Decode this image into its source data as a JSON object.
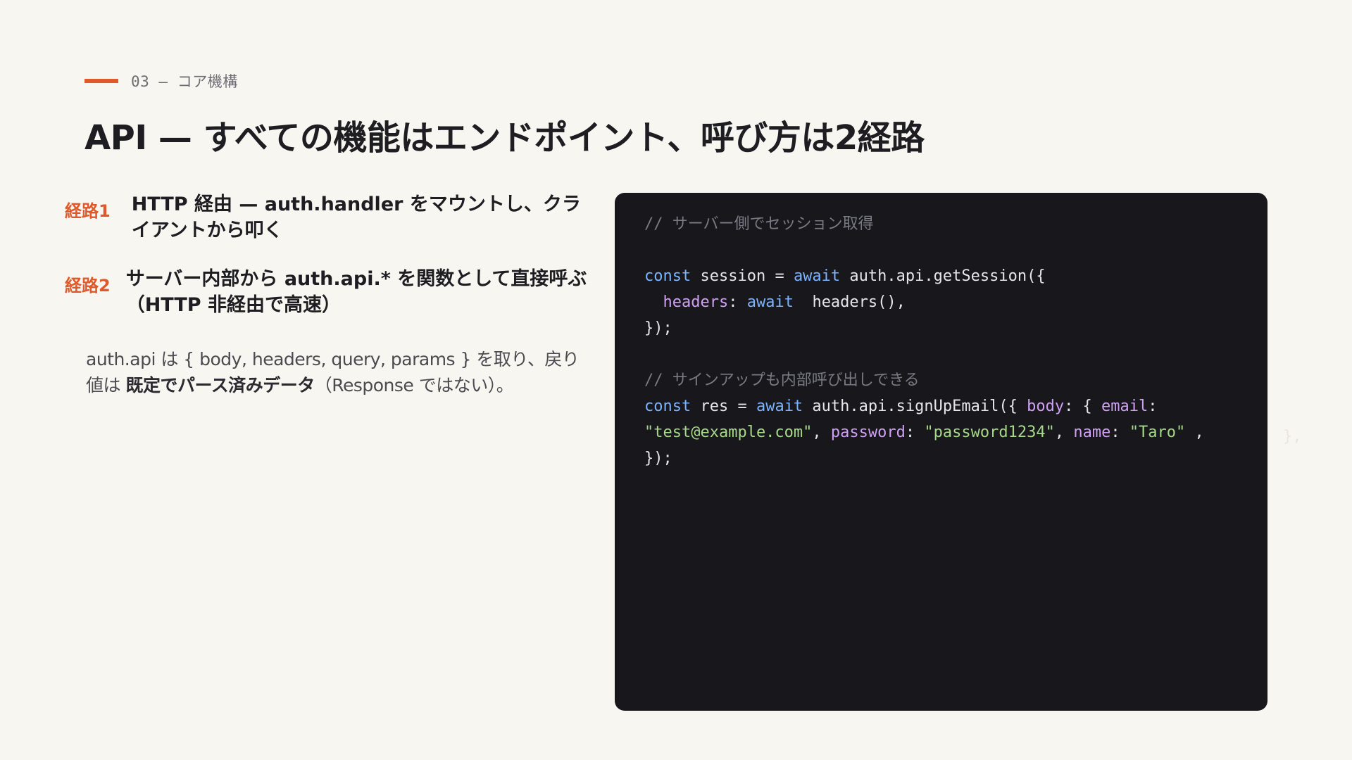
{
  "eyebrow": {
    "label": "03 — コア機構"
  },
  "title": "API — すべての機能はエンドポイント、呼び方は2経路",
  "routes": [
    {
      "label": "経路1",
      "text": "HTTP 経由 — auth.handler をマウントし、クライアントから叩く"
    },
    {
      "label": "経路2",
      "text": "サーバー内部から auth.api.* を関数として直接呼ぶ（HTTP 非経由で高速）"
    }
  ],
  "description": {
    "before": "auth.api は { body, headers, query, params } を取り、戻り値は ",
    "emphasis": "既定でパース済みデータ",
    "after": "（Response ではない）。"
  },
  "code": {
    "comment_1": "// サーバー側でセッション取得",
    "l1_kw_const": "const",
    "l1_text_a": " session = ",
    "l1_kw_await": "await",
    "l1_text_b": " auth.api.getSession({",
    "l2_indent": "  ",
    "l2_prop_headers": "headers",
    "l2_colon": ": ",
    "l2_kw_await": "await",
    "l2_text": "  headers(),",
    "l3_close": "});",
    "comment_2": "// サインアップも内部呼び出しできる",
    "l4_kw_const": "const",
    "l4_text_a": " res = ",
    "l4_kw_await": "await",
    "l4_text_b": " auth.api.signUpEmail({ ",
    "l4_prop_body": "body",
    "l4_text_c": ": { ",
    "l4_prop_email": "email",
    "l4_text_d": ":",
    "l5_str_email": "\"test@example.com\"",
    "l5_text_a": ", ",
    "l5_prop_password": "password",
    "l5_text_b": ": ",
    "l5_str_password": "\"password1234\"",
    "l5_text_c": ", ",
    "l5_prop_name": "name",
    "l5_text_d": ": ",
    "l5_str_name": "\"Taro\"",
    "l5_text_e": " ,",
    "l6_close": "});"
  },
  "overflow_fragment": "},",
  "colors": {
    "accent": "#e0592a",
    "background": "#f8f6f1",
    "code_background": "#17171c",
    "keyword": "#7cb3ff",
    "property": "#d0a0f4",
    "string": "#a6d98a",
    "comment": "#7a7a84"
  }
}
